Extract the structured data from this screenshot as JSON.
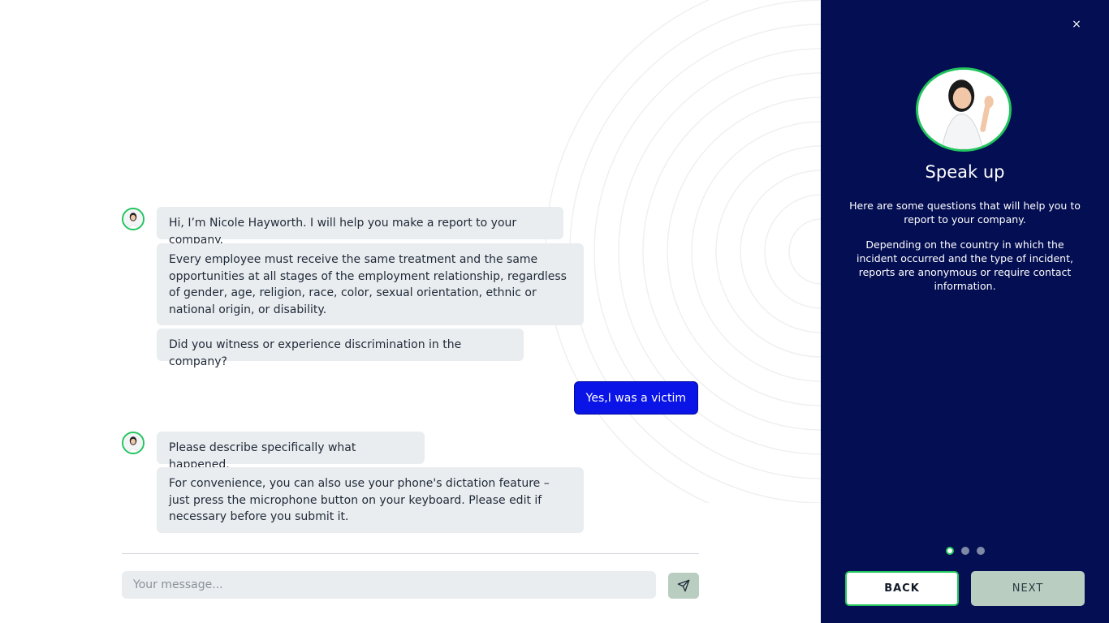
{
  "chat": {
    "messages_first_group": [
      "Hi, I’m Nicole Hayworth. I will help you make a report to your company.",
      "Every employee must receive the same treatment and the same opportunities at all stages of the employment relationship, regardless of gender, age, religion, race, color, sexual orientation, ethnic or national origin, or disability.",
      "Did you witness or experience discrimination in the company?"
    ],
    "user_reply": "Yes,I was a victim",
    "messages_second_group": [
      "Please describe specifically what happened.",
      "For convenience, you can also use your phone's dictation feature – just press the microphone button on your keyboard. Please edit if necessary before you submit it."
    ],
    "input_placeholder": "Your message...",
    "send_icon": "send-icon"
  },
  "panel": {
    "close_icon": "close-icon",
    "close_glyph": "×",
    "title": "Speak up",
    "paragraph_1": "Here are some questions that will help you to report to your company.",
    "paragraph_2": "Depending on the country in which the incident occurred and the type of incident, reports are anonymous or require contact information.",
    "pagination": {
      "total": 3,
      "active": 1
    },
    "back_label": "BACK",
    "next_label": "NEXT"
  },
  "colors": {
    "panel_bg": "#040e52",
    "accent_green": "#22c55e",
    "user_bubble": "#0a14e6",
    "bot_bubble": "#e9edf0",
    "next_button": "#b9cdc1"
  }
}
